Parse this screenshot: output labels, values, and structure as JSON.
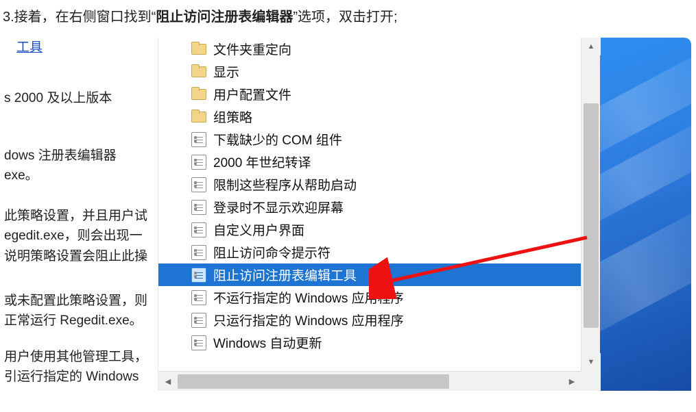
{
  "instruction": {
    "prefix": "3.接着，在右侧窗口找到“",
    "bold": "阻止访问注册表编辑器",
    "suffix": "”选项，双击打开;"
  },
  "left_panel": {
    "link": "工具",
    "block1": "s 2000 及以上版本",
    "block2": "dows 注册表编辑器\nexe。",
    "block3": "此策略设置，并且用户试\negedit.exe，则会出现一\n说明策略设置会阻止此操",
    "block4": "或未配置此策略设置，则\n正常运行 Regedit.exe。",
    "block5": "用户使用其他管理工具，\n引运行指定的 Windows"
  },
  "list": {
    "items": [
      {
        "type": "folder",
        "label": "文件夹重定向"
      },
      {
        "type": "folder",
        "label": "显示"
      },
      {
        "type": "folder",
        "label": "用户配置文件"
      },
      {
        "type": "folder",
        "label": "组策略"
      },
      {
        "type": "setting",
        "label": "下载缺少的 COM 组件"
      },
      {
        "type": "setting",
        "label": "2000 年世纪转译"
      },
      {
        "type": "setting",
        "label": "限制这些程序从帮助启动"
      },
      {
        "type": "setting",
        "label": "登录时不显示欢迎屏幕"
      },
      {
        "type": "setting",
        "label": "自定义用户界面"
      },
      {
        "type": "setting",
        "label": "阻止访问命令提示符"
      },
      {
        "type": "setting",
        "label": "阻止访问注册表编辑工具",
        "selected": true
      },
      {
        "type": "setting",
        "label": "不运行指定的 Windows 应用程序"
      },
      {
        "type": "setting",
        "label": "只运行指定的 Windows 应用程序"
      },
      {
        "type": "setting",
        "label": "Windows 自动更新"
      }
    ]
  },
  "glyphs": {
    "up": "▲",
    "down": "▼",
    "left": "◀",
    "right": "▶"
  }
}
